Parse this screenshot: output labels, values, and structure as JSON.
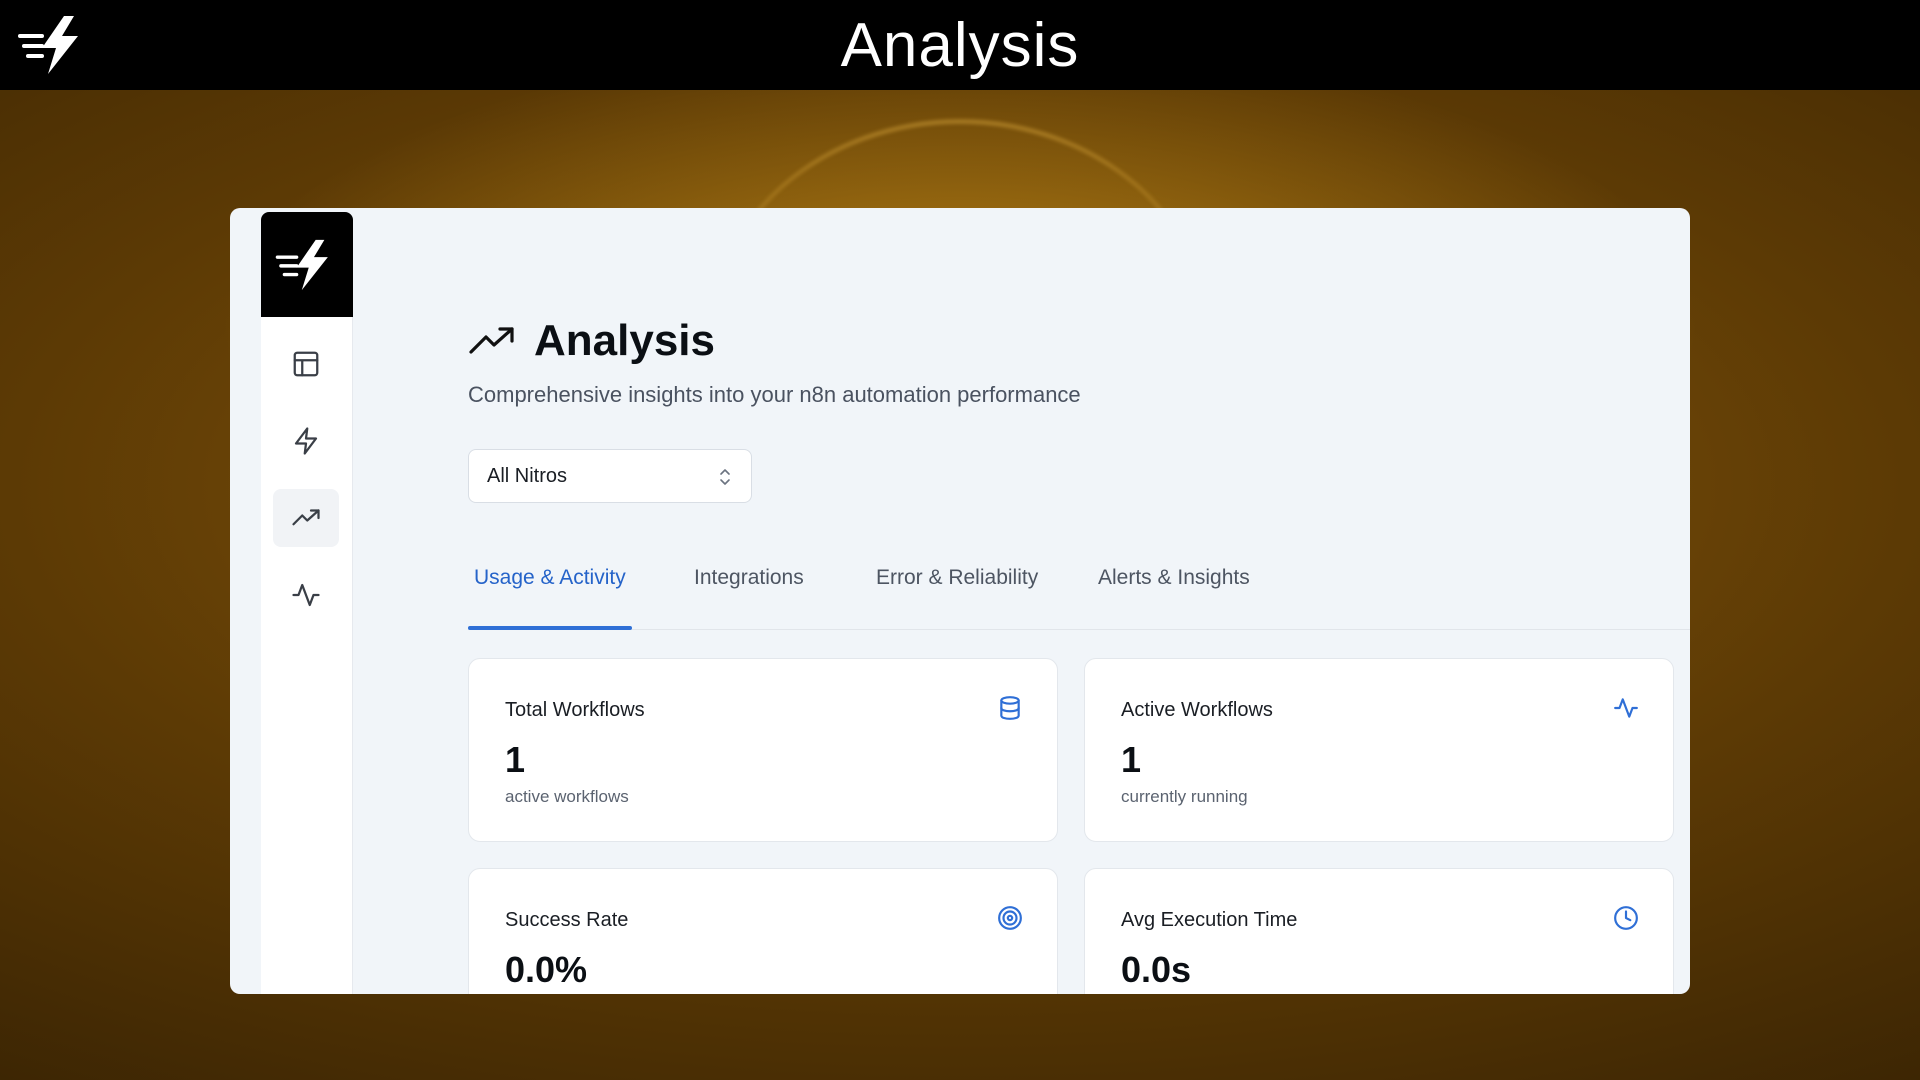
{
  "header": {
    "title": "Analysis"
  },
  "sidebar": {
    "items": [
      {
        "name": "dashboard",
        "icon": "layout-icon",
        "active": false
      },
      {
        "name": "nitros",
        "icon": "bolt-icon",
        "active": false
      },
      {
        "name": "analysis",
        "icon": "trending-up-icon",
        "active": true
      },
      {
        "name": "activity",
        "icon": "activity-icon",
        "active": false
      }
    ]
  },
  "page": {
    "title": "Analysis",
    "subtitle": "Comprehensive insights into your n8n automation performance"
  },
  "filter": {
    "selected": "All Nitros"
  },
  "tabs": [
    {
      "label": "Usage & Activity",
      "active": true
    },
    {
      "label": "Integrations",
      "active": false
    },
    {
      "label": "Error & Reliability",
      "active": false
    },
    {
      "label": "Alerts & Insights",
      "active": false
    }
  ],
  "cards": [
    {
      "label": "Total Workflows",
      "value": "1",
      "note": "active workflows",
      "icon": "database-icon"
    },
    {
      "label": "Active Workflows",
      "value": "1",
      "note": "currently running",
      "icon": "activity-icon"
    },
    {
      "label": "Success Rate",
      "value": "0.0%",
      "note": "",
      "icon": "target-icon"
    },
    {
      "label": "Avg Execution Time",
      "value": "0.0s",
      "note": "",
      "icon": "clock-icon"
    }
  ],
  "colors": {
    "accent": "#2f6fd6",
    "topbar": "#000000",
    "background": "#6b4506"
  }
}
